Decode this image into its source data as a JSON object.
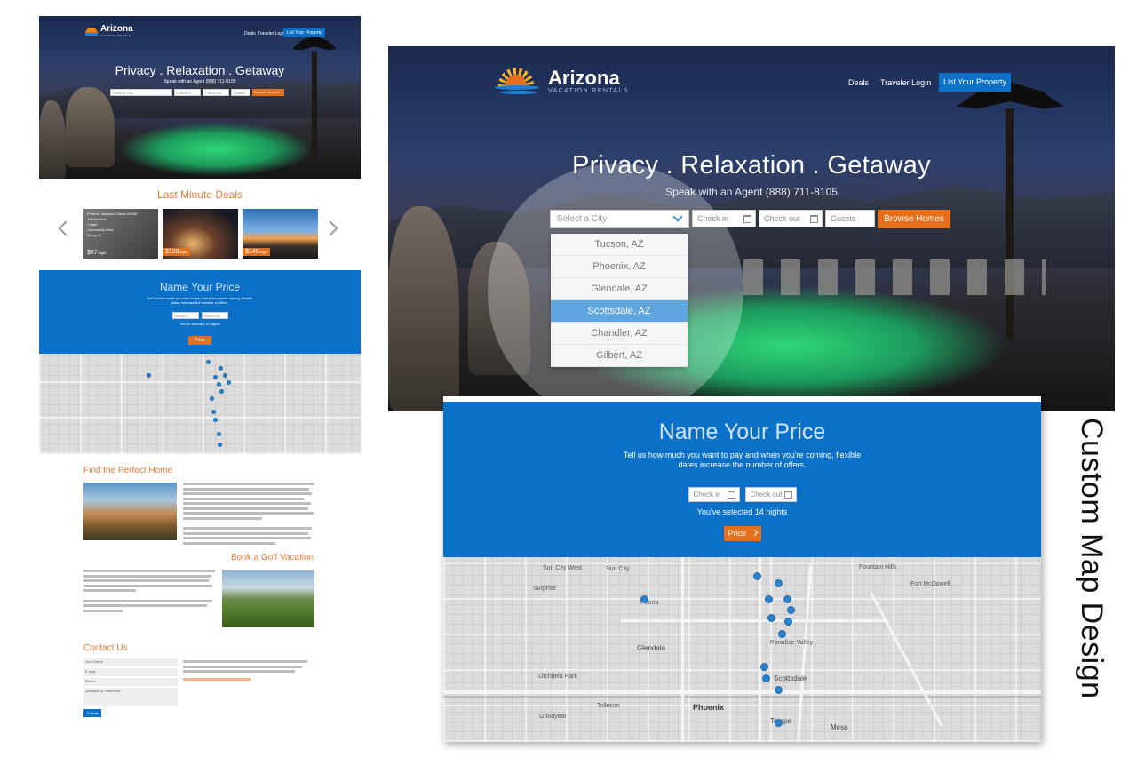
{
  "small": {
    "brand": "Arizona",
    "brand_sub": "VACATION RENTALS",
    "nav": [
      "Deals",
      "Traveler Login",
      "List Your Property"
    ],
    "tagline": "Privacy . Relaxation . Getaway",
    "phone": "Speak with an Agent (888) 711-8105",
    "search": {
      "city": "Select a City",
      "checkin": "Check in",
      "checkout": "Check out",
      "guests": "Guests",
      "browse": "Browse Homes"
    },
    "deals_title": "Last Minute Deals",
    "deal1": {
      "title": "Phoenix Vacation Condo #1085",
      "lines": [
        "1 Bedrooms",
        "1 Bath",
        "Community Pool",
        "Sleeps 4"
      ],
      "price": "$87",
      "per": "/night"
    },
    "deal2": {
      "price": "$138",
      "per": "/night"
    },
    "deal3": {
      "price": "$140",
      "per": "/night"
    },
    "nyp_title": "Name Your Price",
    "nyp_line1": "Tell us how much you want to pay and when you're coming, flexible",
    "nyp_line2": "dates increase the number of offers.",
    "nyp_checkin": "Check in",
    "nyp_checkout": "Check out",
    "nyp_selected": "You've selected 14 nights",
    "nyp_price": "Price",
    "find_title": "Find the Perfect Home",
    "golf_title": "Book a Golf Vacation",
    "contact_title": "Contact Us",
    "contact_fields": [
      "Your Name",
      "E-mail",
      "Phone",
      "Question or Comment"
    ],
    "submit": "Submit"
  },
  "main": {
    "brand": "Arizona",
    "brand_sub": "VACATION RENTALS",
    "nav_deals": "Deals",
    "nav_login": "Traveler Login",
    "nav_list": "List Your Property",
    "tagline": "Privacy . Relaxation . Getaway",
    "phone": "Speak with an Agent (888) 711-8105",
    "city_placeholder": "Select a City",
    "checkin": "Check in",
    "checkout": "Check out",
    "guests": "Guests",
    "browse": "Browse Homes",
    "cities": [
      "Tucson, AZ",
      "Phoenix, AZ",
      "Glendale, AZ",
      "Scottsdale, AZ",
      "Chandler, AZ",
      "Gilbert, AZ"
    ],
    "selected_city": "Scottsdale, AZ"
  },
  "nyp": {
    "title": "Name Your Price",
    "line1": "Tell us how much you want to pay and when you're coming, flexible",
    "line2": "dates increase the number of offers.",
    "checkin": "Check in",
    "checkout": "Check out",
    "selected": "You've selected 14 nights",
    "price": "Price"
  },
  "map_labels": [
    "Sun City West",
    "Sun City",
    "Surprise",
    "Peoria",
    "Glendale",
    "Litchfield Park",
    "Goodyear",
    "Tolleson",
    "Phoenix",
    "Tempe",
    "Mesa",
    "Scottsdale",
    "Paradise Valley",
    "Fort McDowell",
    "Fountain Hills"
  ],
  "side_caption": "Custom Map Design",
  "colors": {
    "blue": "#0a70c8",
    "orange": "#e56f1b",
    "selected": "#60a6de"
  }
}
